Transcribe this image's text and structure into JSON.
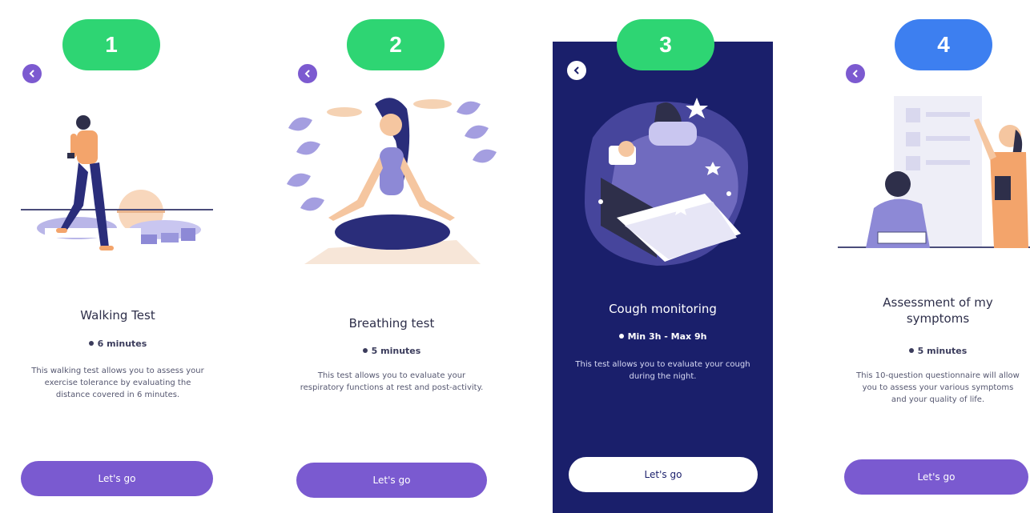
{
  "screens": [
    {
      "step": "1",
      "title": "Walking Test",
      "duration": "6 minutes",
      "description": "This walking test allows you to assess your exercise tolerance by evaluating the distance covered in 6 minutes.",
      "button": "Let's go",
      "illustration": "man-walking-illustration"
    },
    {
      "step": "2",
      "title": "Breathing test",
      "duration": "5 minutes",
      "description": "This test allows you to evaluate your respiratory functions at rest and post-activity.",
      "button": "Let's go",
      "illustration": "woman-meditating-illustration"
    },
    {
      "step": "3",
      "title": "Cough monitoring",
      "duration": "Min 3h - Max 9h",
      "description": "This test allows you to evaluate your cough during the night.",
      "button": "Let's go",
      "illustration": "woman-sleeping-illustration"
    },
    {
      "step": "4",
      "title": "Assessment of my symptoms",
      "duration": "5 minutes",
      "description": "This 10-question questionnaire will allow you to assess your various symptoms and your quality of life.",
      "button": "Let's go",
      "illustration": "doctor-and-patient-illustration"
    }
  ],
  "colors": {
    "badge_green": "#2ed573",
    "badge_blue": "#3d7ff0",
    "accent_purple": "#7a5ad0",
    "dark_navy": "#1a1f6b"
  }
}
